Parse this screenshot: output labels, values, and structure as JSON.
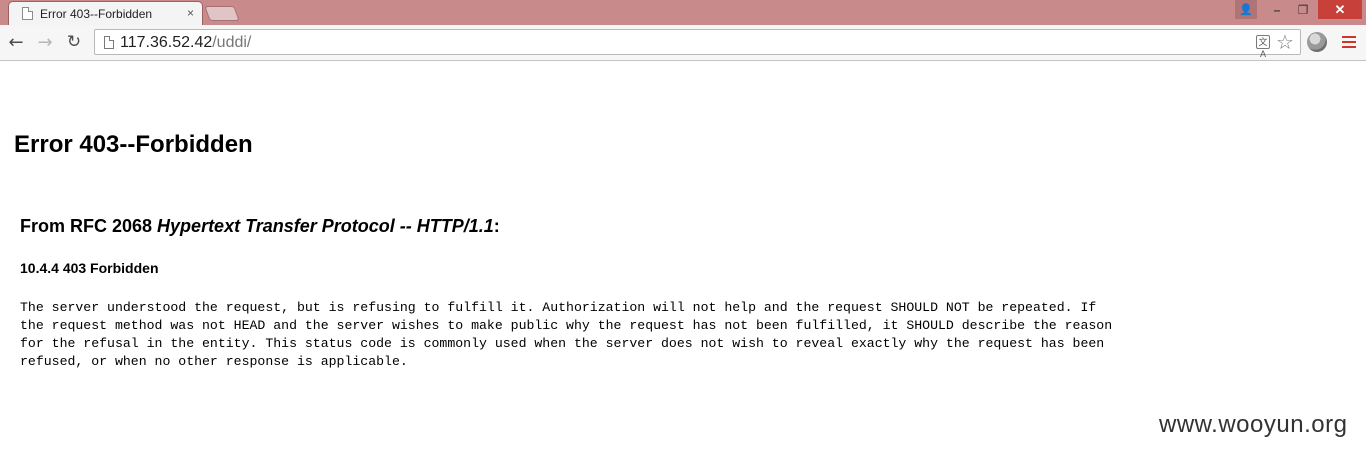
{
  "browser": {
    "tab": {
      "title": "Error 403--Forbidden",
      "close_glyph": "×",
      "favicon": "page-icon"
    },
    "window_controls": {
      "user": "👤",
      "minimize": "–",
      "maximize": "❐",
      "close": "✕"
    },
    "toolbar": {
      "back": "←",
      "forward": "→",
      "reload": "↻",
      "url_host": "117.36.52.42",
      "url_path": "/uddi/",
      "translate": "文A",
      "bookmark": "☆",
      "extension_icon": "globe-icon",
      "menu_icon": "hamburger-menu-icon",
      "menu_color": "#d0342b"
    },
    "titlebar_color": "#c98a8c"
  },
  "page": {
    "heading": "Error 403--Forbidden",
    "rfc": {
      "prefix": "From RFC 2068 ",
      "emphasis": "Hypertext Transfer Protocol -- HTTP/1.1",
      "suffix": ":"
    },
    "section": "10.4.4 403 Forbidden",
    "body_lines": [
      "The server understood the request, but is refusing to fulfill it. Authorization will not help and the request SHOULD NOT be repeated. If",
      "the request method was not HEAD and the server wishes to make public why the request has not been fulfilled, it SHOULD describe the reason",
      "for the refusal in the entity. This status code is commonly used when the server does not wish to reveal exactly why the request has been",
      "refused, or when no other response is applicable."
    ]
  },
  "watermark": "www.wooyun.org"
}
